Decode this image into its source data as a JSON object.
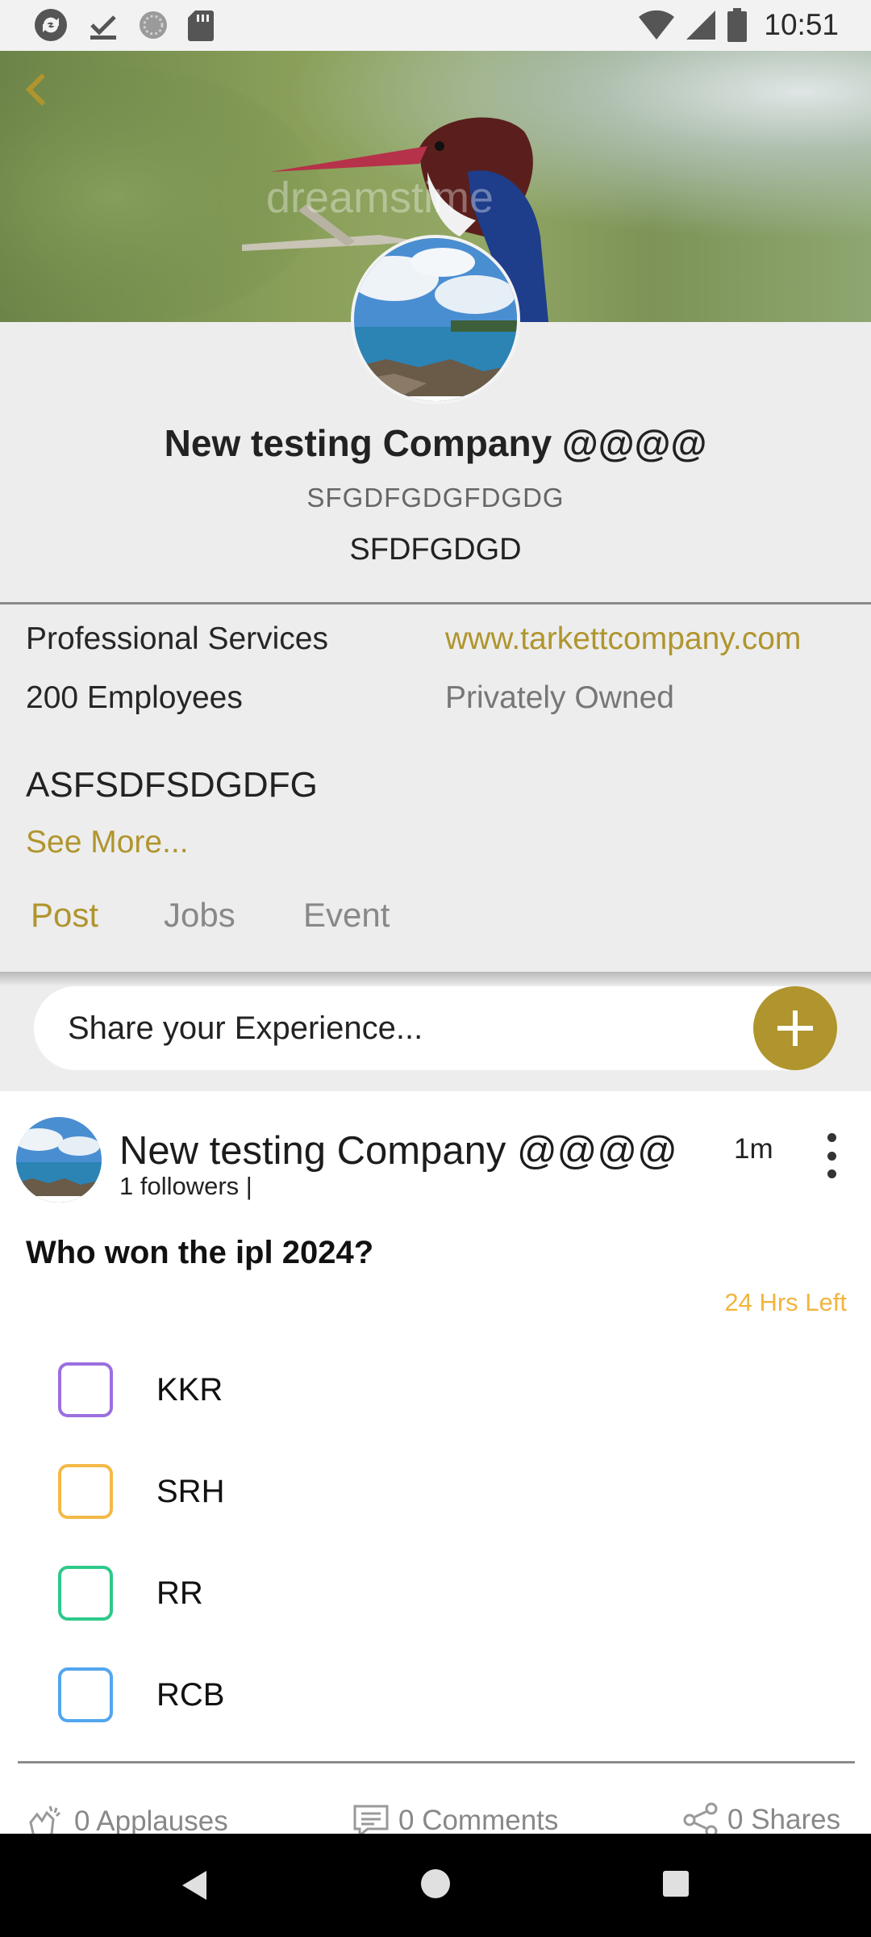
{
  "status_bar": {
    "time": "10:51",
    "left_icons": [
      "sync-icon",
      "download-done-icon",
      "circle-dots-icon",
      "sd-card-icon"
    ],
    "right_icons": [
      "wifi-icon",
      "cell-signal-icon",
      "battery-icon"
    ]
  },
  "header": {
    "back_icon": "chevron-left-icon",
    "cover_watermark": "dreamstime"
  },
  "company": {
    "name": "New testing Company @@@@",
    "tagline": "SFGDFGDGFDGDG",
    "subtitle": "SFDFGDGD",
    "industry": "Professional Services",
    "website": "www.tarkettcompany.com",
    "employees": "200 Employees",
    "ownership": "Privately Owned",
    "about": "ASFSDFSDGDFG",
    "see_more": "See More..."
  },
  "tabs": [
    {
      "label": "Post",
      "active": true
    },
    {
      "label": "Jobs",
      "active": false
    },
    {
      "label": "Event",
      "active": false
    }
  ],
  "share": {
    "placeholder": "Share your Experience...",
    "add_icon": "plus-icon"
  },
  "post": {
    "author": "New testing Company @@@@",
    "followers": "1 followers |",
    "time": "1m",
    "question": "Who won the ipl 2024?",
    "time_left": "24 Hrs Left",
    "options": [
      {
        "label": "KKR",
        "color": "#9b6fe0"
      },
      {
        "label": "SRH",
        "color": "#f5b947"
      },
      {
        "label": "RR",
        "color": "#2ec98a"
      },
      {
        "label": "RCB",
        "color": "#52a6ee"
      }
    ],
    "stats": {
      "applauses": "0 Applauses",
      "comments": "0 Comments",
      "shares": "0 Shares"
    }
  },
  "colors": {
    "accent": "#b0952e",
    "time_left": "#f0b540"
  },
  "nav": {
    "icons": [
      "back-triangle-icon",
      "home-circle-icon",
      "recents-square-icon"
    ]
  }
}
